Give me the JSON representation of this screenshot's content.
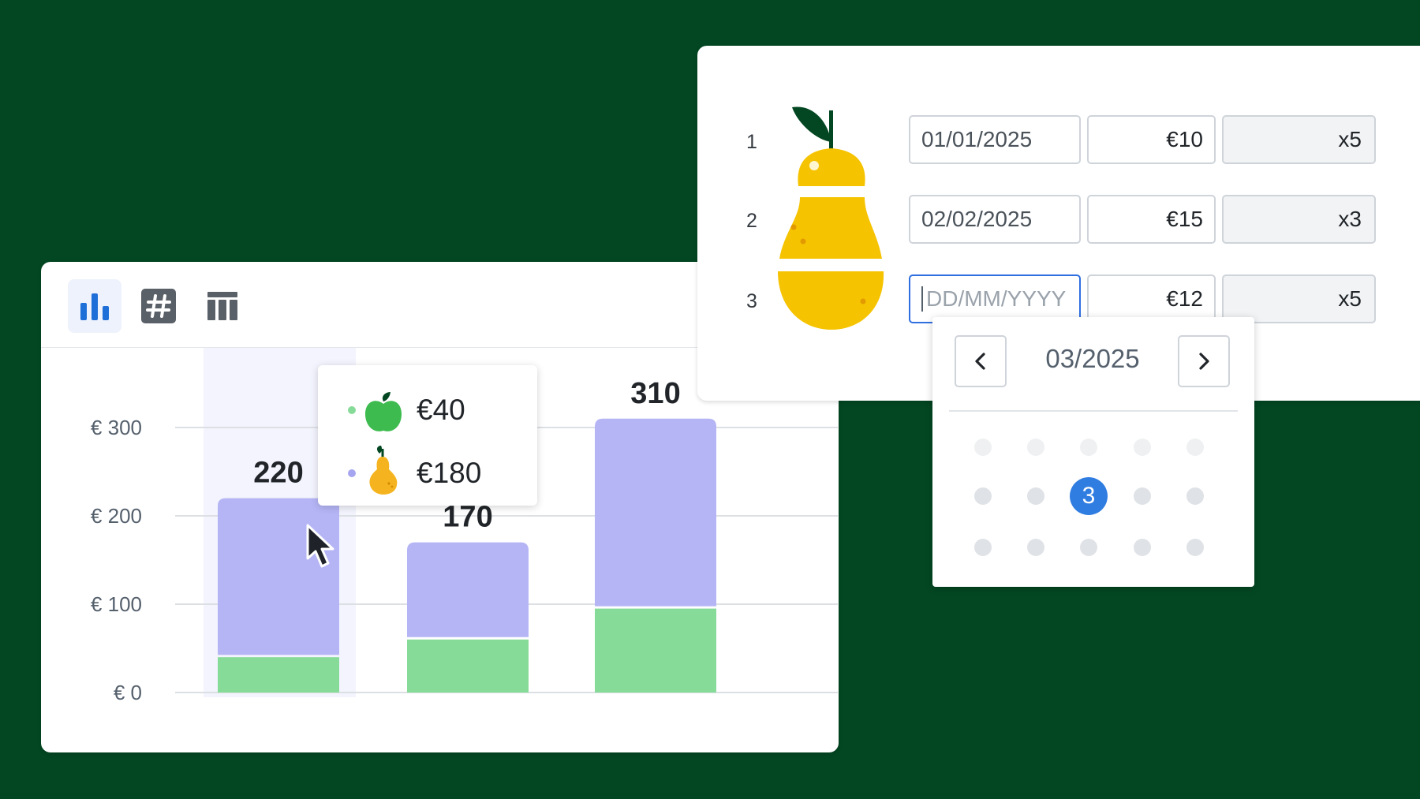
{
  "colors": {
    "background": "#034722",
    "pear_series": "#b5b5f6",
    "apple_series": "#87db98",
    "accent": "#2f7de1",
    "pear_fill": "#f5c300",
    "leaf": "#034722"
  },
  "chart_toolbar": {
    "buttons": [
      {
        "icon": "bar-chart-icon",
        "active": true
      },
      {
        "icon": "number-icon",
        "active": false
      },
      {
        "icon": "table-icon",
        "active": false
      }
    ]
  },
  "chart_data": {
    "type": "bar",
    "stacked": true,
    "categories": [
      "",
      "",
      ""
    ],
    "series": [
      {
        "values": [
          40,
          60,
          95
        ]
      },
      {
        "values": [
          180,
          110,
          215
        ]
      }
    ],
    "totals": [
      "220",
      "170",
      "310"
    ],
    "ylim": [
      0,
      310
    ],
    "yticks": [
      {
        "value": 0,
        "label": "€ 0"
      },
      {
        "value": 100,
        "label": "€ 100"
      },
      {
        "value": 200,
        "label": "€ 200"
      },
      {
        "value": 300,
        "label": "€ 300"
      }
    ],
    "grid": true,
    "hovered_index": 0
  },
  "tooltip": {
    "rows": [
      {
        "icon": "apple-icon",
        "value": "€40"
      },
      {
        "icon": "pear-icon",
        "value": "€180"
      }
    ]
  },
  "form": {
    "rows": [
      {
        "number": "1",
        "date": "01/01/2025",
        "price": "€10",
        "quantity": "x5"
      },
      {
        "number": "2",
        "date": "02/02/2025",
        "price": "€15",
        "quantity": "x3"
      },
      {
        "number": "3",
        "date": "",
        "date_placeholder": "DD/MM/YYYY",
        "price": "€12",
        "quantity": "x5"
      }
    ]
  },
  "date_picker": {
    "month": "03/2025",
    "selected_day": "3"
  }
}
